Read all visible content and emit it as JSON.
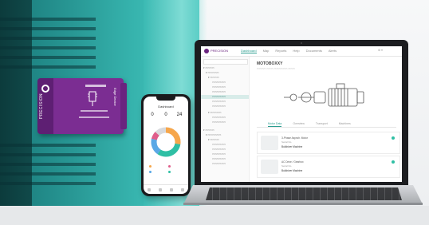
{
  "sensor": {
    "brand": "PRECISION",
    "side_text": "Edge Device"
  },
  "phone": {
    "title": "Dashboard",
    "stats": [
      {
        "value": "0"
      },
      {
        "value": "0"
      },
      {
        "value": "24"
      }
    ],
    "donut_colors": [
      "#f6a64b",
      "#2fbfa4",
      "#5aa8e6",
      "#e05d8a",
      "#d8dadd"
    ]
  },
  "laptop": {
    "brand": "PRECISION",
    "nav": [
      "Dashboard",
      "Map",
      "Reports",
      "Help",
      "Documents",
      "Alerts"
    ],
    "active_nav": "Dashboard",
    "page_title": "MOTOBOXXY",
    "tabs": [
      "Motor Data",
      "Overview",
      "Transport",
      "Machines"
    ],
    "active_tab": "Motor Data",
    "cards": [
      {
        "line1": "3-Phase Asynch. Motor",
        "line2": "Serial No.",
        "line3": "Bulldriver Machine"
      },
      {
        "line1": "AC Drive / Gearbox",
        "line2": "Serial No.",
        "line3": "Bulldriver Machine"
      }
    ],
    "accent": "#2a9d8f"
  },
  "colors": {
    "sensor": "#7b2d92",
    "motor": "#36b3ad"
  }
}
